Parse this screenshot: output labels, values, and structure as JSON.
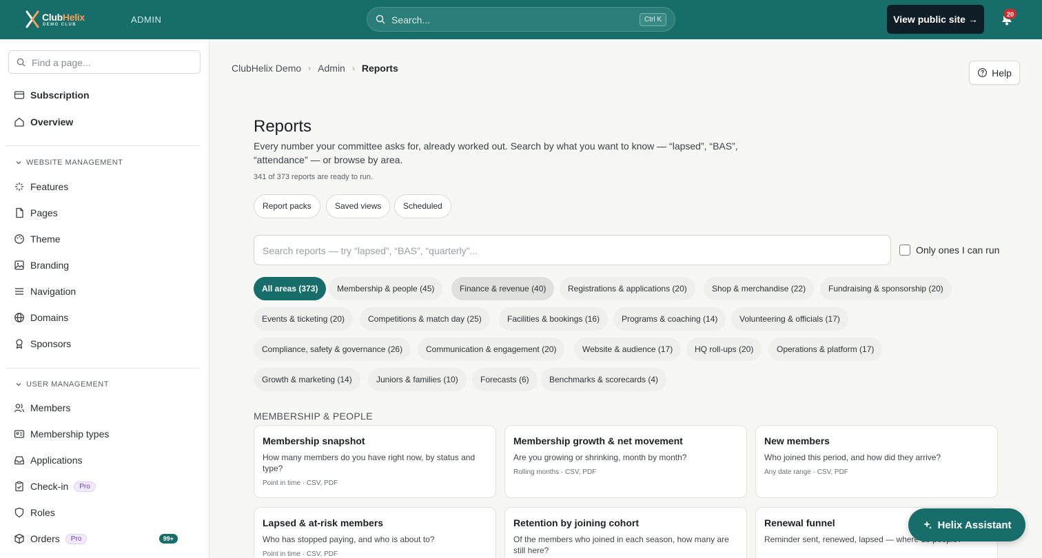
{
  "topbar": {
    "logo_prefix": "Club",
    "logo_suffix": "Helix",
    "logo_sub": "DEMO CLUB",
    "admin_label": "ADMIN",
    "search_placeholder": "Search...",
    "search_shortcut": "Ctrl K",
    "view_site": "View public site →",
    "notification_count": "20"
  },
  "sidebar": {
    "search_placeholder": "Find a page...",
    "top_items": [
      "Subscription",
      "Overview"
    ],
    "sections": [
      {
        "title": "WEBSITE MANAGEMENT",
        "items": [
          "Features",
          "Pages",
          "Theme",
          "Branding",
          "Navigation",
          "Domains",
          "Sponsors"
        ]
      },
      {
        "title": "USER MANAGEMENT",
        "items": [
          "Members",
          "Membership types",
          "Applications",
          "Check-in",
          "Roles",
          "Orders"
        ]
      }
    ],
    "pro_label": "Pro",
    "orders_count": "99+"
  },
  "breadcrumb": [
    "ClubHelix Demo",
    "Admin",
    "Reports"
  ],
  "help_label": "Help",
  "page": {
    "title": "Reports",
    "description": "Every number your committee asks for, already worked out. Search by what you want to know — “lapsed”, “BAS”, “attendance” — or browse by area.",
    "count": "341 of 373 reports are ready to run."
  },
  "quick_buttons": [
    "Report packs",
    "Saved views",
    "Scheduled"
  ],
  "report_search_placeholder": "Search reports — try “lapsed”, “BAS”, “quarterly”...",
  "only_run_label": "Only ones I can run",
  "chips": [
    "All areas (373)",
    "Membership & people (45)",
    "Finance & revenue (40)",
    "Registrations & applications (20)",
    "Shop & merchandise (22)",
    "Fundraising & sponsorship (20)",
    "Events & ticketing (20)",
    "Competitions & match day (25)",
    "Facilities & bookings (16)",
    "Programs & coaching (14)",
    "Volunteering & officials (17)",
    "Compliance, safety & governance (26)",
    "Communication & engagement (20)",
    "Website & audience (17)",
    "HQ roll-ups (20)",
    "Operations & platform (17)",
    "Growth & marketing (14)",
    "Juniors & families (10)",
    "Forecasts (6)",
    "Benchmarks & scorecards (4)"
  ],
  "section_title": "MEMBERSHIP & PEOPLE",
  "cards": [
    {
      "title": "Membership snapshot",
      "desc": "How many members do you have right now, by status and type?",
      "meta": "Point in time · CSV, PDF"
    },
    {
      "title": "Membership growth & net movement",
      "desc": "Are you growing or shrinking, month by month?",
      "meta": "Rolling months · CSV, PDF"
    },
    {
      "title": "New members",
      "desc": "Who joined this period, and how did they arrive?",
      "meta": "Any date range · CSV, PDF"
    },
    {
      "title": "Lapsed & at-risk members",
      "desc": "Who has stopped paying, and who is about to?",
      "meta": "Point in time · CSV, PDF"
    },
    {
      "title": "Retention by joining cohort",
      "desc": "Of the members who joined in each season, how many are still here?",
      "meta": ""
    },
    {
      "title": "Renewal funnel",
      "desc": "Reminder sent, renewed, lapsed — where do people?",
      "meta": ""
    }
  ],
  "assistant_label": "Helix Assistant"
}
